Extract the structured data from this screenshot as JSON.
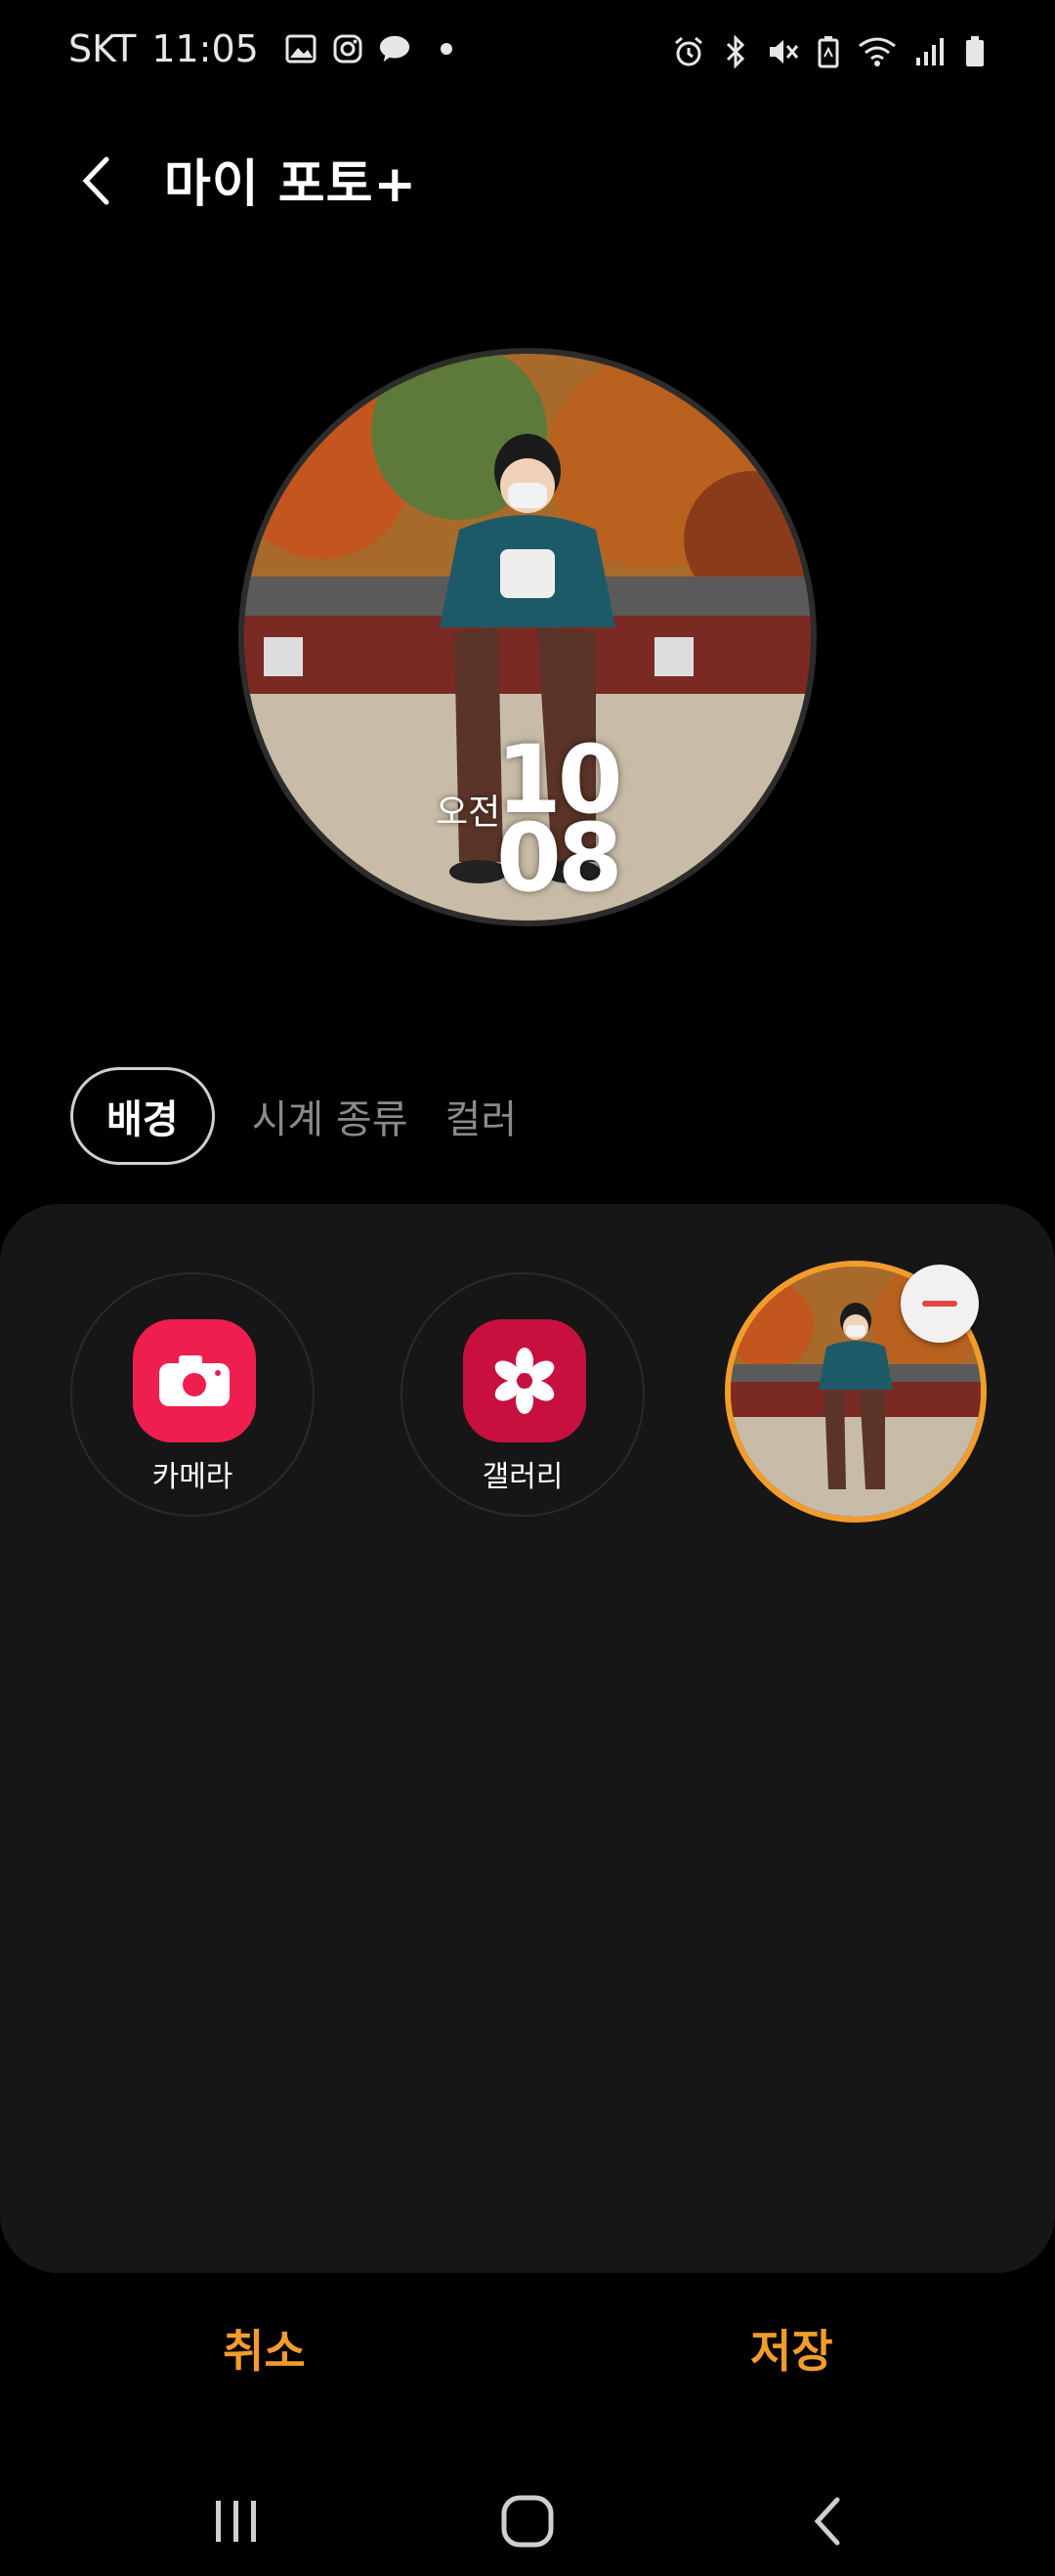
{
  "status_bar": {
    "carrier": "SKT",
    "time": "11:05",
    "left_icons": [
      "gallery-notification-icon",
      "instagram-icon",
      "kakaotalk-icon",
      "more-notifications-dot"
    ],
    "right_icons": [
      "alarm-icon",
      "bluetooth-icon",
      "mute-icon",
      "battery-saver-icon",
      "wifi-icon",
      "signal-icon",
      "battery-icon"
    ]
  },
  "header": {
    "title": "마이 포토+"
  },
  "watch_preview": {
    "ampm": "오전",
    "hour": "10",
    "minute": "08"
  },
  "tabs": [
    {
      "label": "배경",
      "active": true
    },
    {
      "label": "시계 종류",
      "active": false
    },
    {
      "label": "컬러",
      "active": false
    }
  ],
  "backgrounds": {
    "items": [
      {
        "label": "카메라",
        "icon": "camera-icon",
        "color": "#ee1f4f"
      },
      {
        "label": "갤러리",
        "icon": "gallery-flower-icon",
        "color": "#c8103f"
      }
    ],
    "selected_photo_border": "#f29d2a"
  },
  "actions": {
    "cancel": "취소",
    "save": "저장",
    "color": "#f29d2a"
  }
}
